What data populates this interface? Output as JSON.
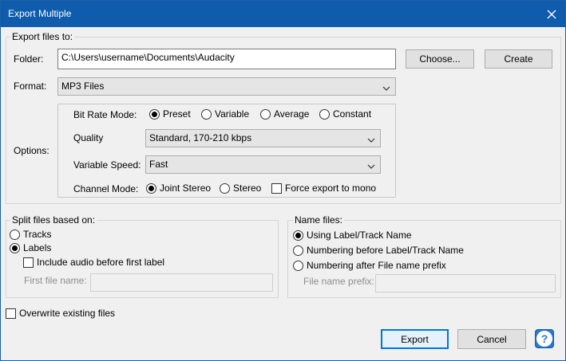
{
  "window": {
    "title": "Export Multiple"
  },
  "export_group": {
    "legend": "Export files to:",
    "folder_label": "Folder:",
    "folder_value": "C:\\Users\\username\\Documents\\Audacity",
    "choose_label": "Choose...",
    "create_label": "Create",
    "format_label": "Format:",
    "format_value": "MP3 Files",
    "options_label": "Options:",
    "bit_rate_label": "Bit Rate Mode:",
    "bit_rate_modes": [
      "Preset",
      "Variable",
      "Average",
      "Constant"
    ],
    "bit_rate_selected": "Preset",
    "quality_label": "Quality",
    "quality_value": "Standard, 170-210 kbps",
    "variable_speed_label": "Variable Speed:",
    "variable_speed_value": "Fast",
    "channel_mode_label": "Channel Mode:",
    "channel_modes": [
      "Joint Stereo",
      "Stereo"
    ],
    "channel_selected": "Joint Stereo",
    "force_mono_label": "Force export to mono"
  },
  "split_group": {
    "legend": "Split files based on:",
    "tracks_label": "Tracks",
    "labels_label": "Labels",
    "selected": "Labels",
    "include_audio_label": "Include audio before first label",
    "first_file_label": "First file name:",
    "first_file_value": ""
  },
  "name_group": {
    "legend": "Name files:",
    "options": [
      "Using Label/Track Name",
      "Numbering before Label/Track Name",
      "Numbering after File name prefix"
    ],
    "selected": "Using Label/Track Name",
    "prefix_label": "File name prefix:",
    "prefix_value": ""
  },
  "overwrite_label": "Overwrite existing files",
  "buttons": {
    "export": "Export",
    "cancel": "Cancel",
    "help": "?"
  },
  "colors": {
    "titlebar": "#0f5cad",
    "accent": "#0078d7",
    "help": "#2b78d3"
  }
}
